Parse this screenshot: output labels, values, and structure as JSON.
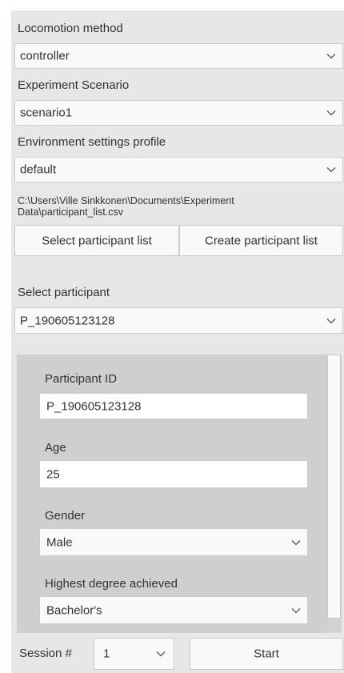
{
  "locomotion": {
    "label": "Locomotion method",
    "value": "controller"
  },
  "scenario": {
    "label": "Experiment Scenario",
    "value": "scenario1"
  },
  "environment": {
    "label": "Environment settings profile",
    "value": "default"
  },
  "participant_list": {
    "path_line1": "C:\\Users\\Ville Sinkkonen\\Documents\\Experiment",
    "path_line2": "Data\\participant_list.csv",
    "select_button": "Select participant list",
    "create_button": "Create participant list"
  },
  "select_participant": {
    "label": "Select participant",
    "value": "P_190605123128"
  },
  "form": {
    "participant_id": {
      "label": "Participant ID",
      "value": "P_190605123128"
    },
    "age": {
      "label": "Age",
      "value": "25"
    },
    "gender": {
      "label": "Gender",
      "value": "Male"
    },
    "degree": {
      "label": "Highest degree achieved",
      "value": "Bachelor's"
    }
  },
  "session": {
    "label": "Session #",
    "value": "1"
  },
  "start_button": "Start",
  "icons": {
    "dropdown": "chevron-down-icon"
  }
}
